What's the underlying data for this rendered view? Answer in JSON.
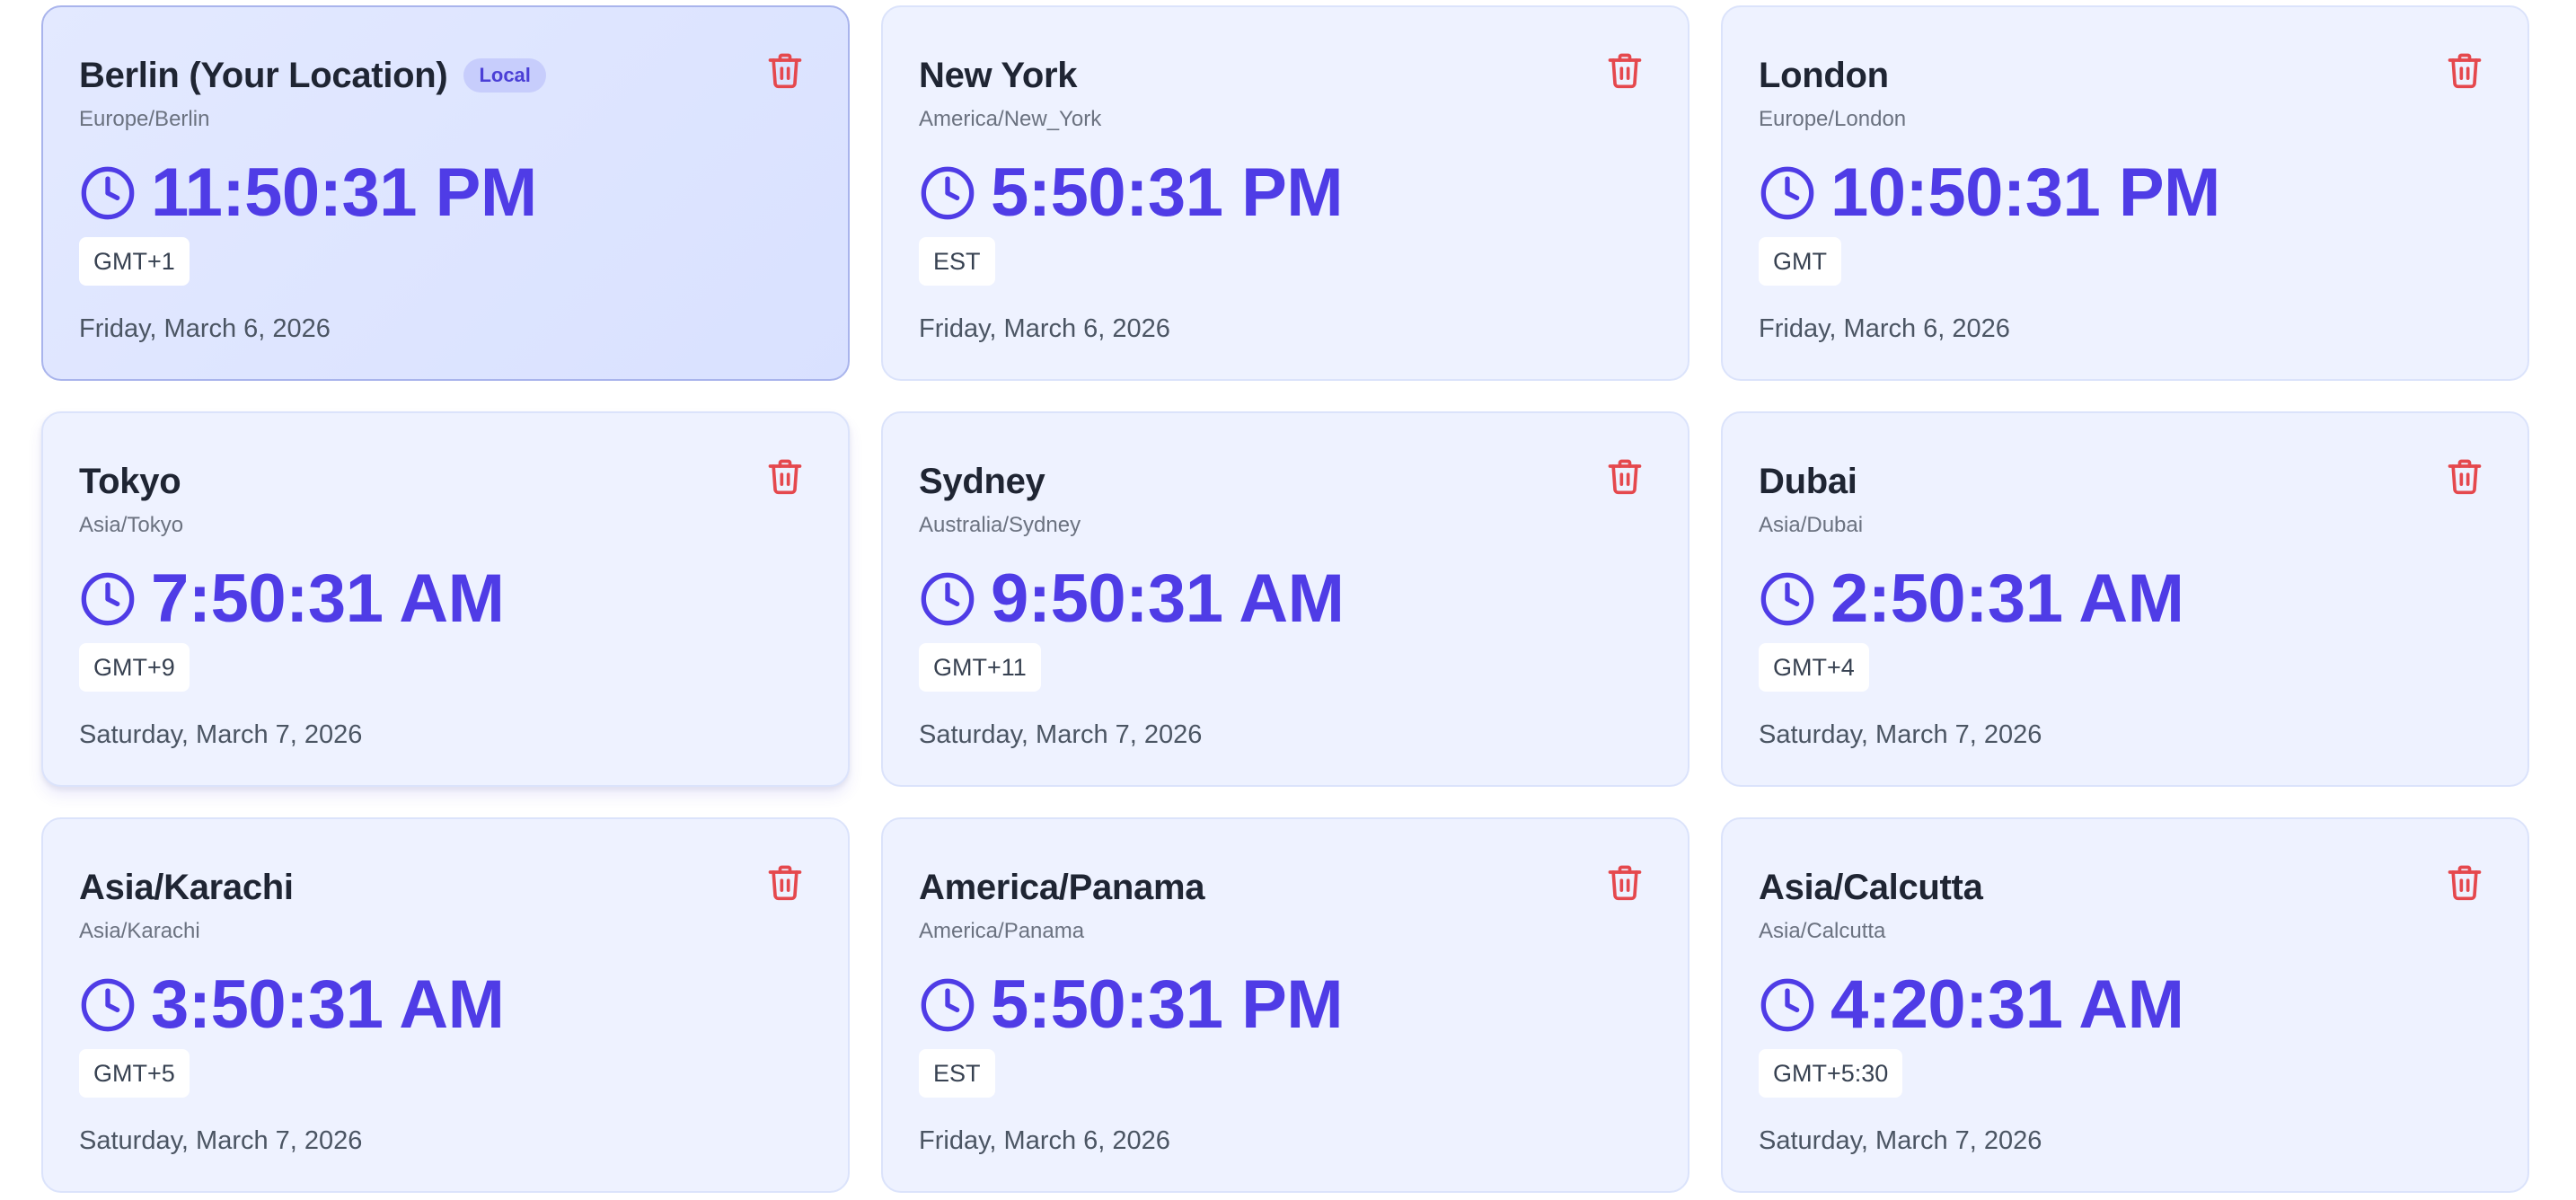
{
  "colors": {
    "accent": "#4f3ce6",
    "card_background": "#eef2ff",
    "local_card_background": "#dde4ff",
    "delete_red": "#e5484d"
  },
  "icons": {
    "clock": "clock-icon",
    "delete": "trash-icon"
  },
  "clocks": [
    {
      "city": "Berlin (Your Location)",
      "badge": "Local",
      "zone": "Europe/Berlin",
      "time": "11:50:31 PM",
      "tz": "GMT+1",
      "date": "Friday, March 6, 2026"
    },
    {
      "city": "New York",
      "zone": "America/New_York",
      "time": "5:50:31 PM",
      "tz": "EST",
      "date": "Friday, March 6, 2026"
    },
    {
      "city": "London",
      "zone": "Europe/London",
      "time": "10:50:31 PM",
      "tz": "GMT",
      "date": "Friday, March 6, 2026"
    },
    {
      "city": "Tokyo",
      "zone": "Asia/Tokyo",
      "time": "7:50:31 AM",
      "tz": "GMT+9",
      "date": "Saturday, March 7, 2026"
    },
    {
      "city": "Sydney",
      "zone": "Australia/Sydney",
      "time": "9:50:31 AM",
      "tz": "GMT+11",
      "date": "Saturday, March 7, 2026"
    },
    {
      "city": "Dubai",
      "zone": "Asia/Dubai",
      "time": "2:50:31 AM",
      "tz": "GMT+4",
      "date": "Saturday, March 7, 2026"
    },
    {
      "city": "Asia/Karachi",
      "zone": "Asia/Karachi",
      "time": "3:50:31 AM",
      "tz": "GMT+5",
      "date": "Saturday, March 7, 2026"
    },
    {
      "city": "America/Panama",
      "zone": "America/Panama",
      "time": "5:50:31 PM",
      "tz": "EST",
      "date": "Friday, March 6, 2026"
    },
    {
      "city": "Asia/Calcutta",
      "zone": "Asia/Calcutta",
      "time": "4:20:31 AM",
      "tz": "GMT+5:30",
      "date": "Saturday, March 7, 2026"
    }
  ]
}
